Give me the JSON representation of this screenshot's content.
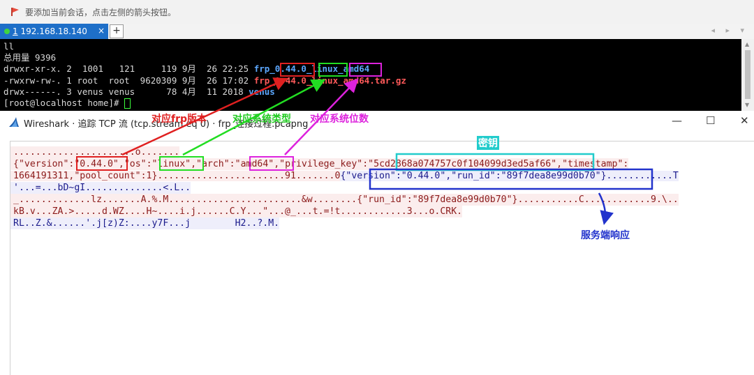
{
  "notice": {
    "text": "要添加当前会话，点击左侧的箭头按钮。"
  },
  "tabs": [
    {
      "index": "1",
      "label": "192.168.18.140",
      "close": "×"
    }
  ],
  "tab_add": "+",
  "tab_nav": "◂ ▸ ▾",
  "terminal": {
    "cmd": "ll",
    "total": "总用量 9396",
    "l1": {
      "perm": "drwxr-xr-x. 2  1001   121     119 9月  26 22:25 ",
      "name_a": "frp_",
      "ver": "0.44.0",
      "sep": "_",
      "os": "linux",
      "arch": "amd64"
    },
    "l2": {
      "perm": "-rwxrw-rw-. 1 root  root  9620309 9月  26 17:02 ",
      "name": "frp_0.44.0_linux_amd64.tar.gz"
    },
    "l3": {
      "perm": "drwx------. 3 venus venus      78 4月  11 2018 ",
      "name": "venus"
    },
    "prompt": "[root@localhost home]# "
  },
  "wireshark": {
    "title": "Wireshark · 追踪 TCP 流 (tcp.stream eq 0) · frp_连接过程.pcapng",
    "min": "—",
    "max": "☐",
    "close": "✕",
    "r1": "......................o.......",
    "r2": {
      "a": "{\"version\":",
      "ver": "\"0.44.0\"",
      "b": ",\"os\":",
      "os": "\"linux\"",
      "c": ",\"arch\":",
      "arch": "\"amd64\"",
      "d": ",\"privilege_key\":\"",
      "key": "5cd2868a074757c0f104099d3ed5af66",
      "e": "\",\"timestamp\":"
    },
    "r3": {
      "a": "1664191311,\"pool_count\":1}.......................91.......0",
      "b": "{\"version\":\"0.44.0\",\"run_id\":\"89f7dea8e99d0b70\"}",
      "c": "............T"
    },
    "r4": "'...=...bD~gI..............<.L..",
    "r5": "_.............lz.......A.%.M........................&w........{\"run_id\":\"89f7dea8e99d0b70\"}...........C............9.\\..",
    "r6": "kB.v...ZA.>.....d.WZ....H~....i.j......C.Y...\"...@_...t.=!t............3...o.CRK.",
    "r7": "RL..Z.&......'.j[z)Z:....y7F...j        H2..?.M."
  },
  "annotations": {
    "frp_version": "对应frp版本",
    "os_type": "对应系统类型",
    "os_bits": "对应系统位数",
    "key": "密钥",
    "server_resp": "服务端响应"
  },
  "colors": {
    "red": "#e02020",
    "green": "#22dd22",
    "magenta": "#dd22dd",
    "cyan": "#22cccc",
    "blue": "#2233cc",
    "tab_blue": "#1e6fc8"
  }
}
